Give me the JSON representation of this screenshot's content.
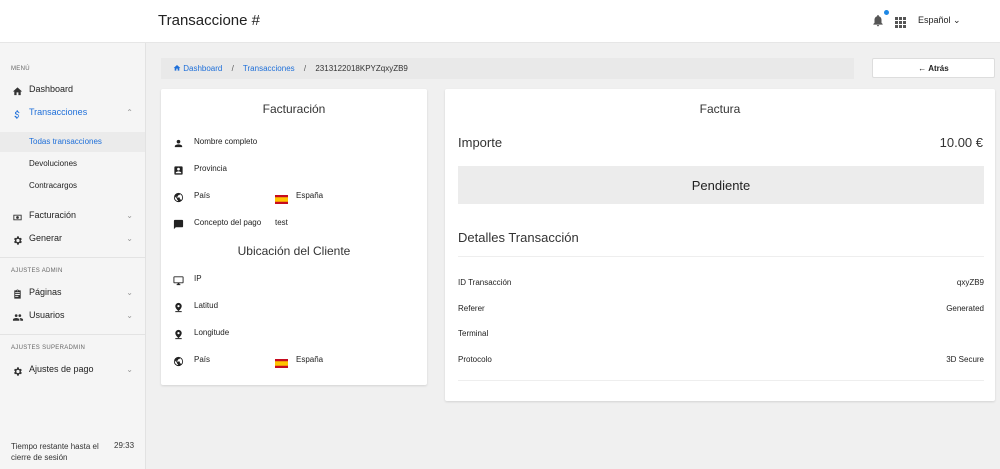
{
  "header": {
    "title": "Transaccione #",
    "language": "Español"
  },
  "sidebar": {
    "menu_label": "MENÚ",
    "items": [
      {
        "label": "Dashboard",
        "icon": "home-icon"
      },
      {
        "label": "Transacciones",
        "icon": "dollar-icon"
      },
      {
        "label": "Facturación",
        "icon": "invoice-icon"
      },
      {
        "label": "Generar",
        "icon": "gear-icon"
      }
    ],
    "sub_items": [
      "Todas transacciones",
      "Devoluciones",
      "Contracargos"
    ],
    "admin_label": "AJUSTES ADMIN",
    "admin_items": [
      {
        "label": "Páginas",
        "icon": "clipboard-icon"
      },
      {
        "label": "Usuarios",
        "icon": "people-icon"
      }
    ],
    "superadmin_label": "AJUSTES SUPERADMIN",
    "superadmin_items": [
      {
        "label": "Ajustes de pago",
        "icon": "gear-icon"
      }
    ],
    "session_text": "Tiempo restante hasta el cierre de sesión",
    "session_time": "29:33"
  },
  "breadcrumb": {
    "home": "Dashboard",
    "section": "Transacciones",
    "current": "2313122018KPYZqxyZB9"
  },
  "back_label": "← Atrás",
  "billing": {
    "title": "Facturación",
    "rows": [
      {
        "label": "Nombre completo",
        "value": ""
      },
      {
        "label": "Provincia",
        "value": ""
      },
      {
        "label": "País",
        "value": "España"
      },
      {
        "label": "Concepto del pago",
        "value": "test"
      }
    ]
  },
  "location": {
    "title": "Ubicación del Cliente",
    "rows": [
      {
        "label": "IP",
        "value": ""
      },
      {
        "label": "Latitud",
        "value": ""
      },
      {
        "label": "Longitude",
        "value": ""
      },
      {
        "label": "País",
        "value": "España"
      }
    ]
  },
  "invoice": {
    "title": "Factura",
    "amount_label": "Importe",
    "amount_value": "10.00 €",
    "status": "Pendiente",
    "details_title": "Detalles Transacción",
    "details": [
      {
        "label": "ID Transacción",
        "value": "qxyZB9"
      },
      {
        "label": "Referer",
        "value": "Generated"
      },
      {
        "label": "Terminal",
        "value": ""
      },
      {
        "label": "Protocolo",
        "value": "3D Secure"
      }
    ]
  },
  "colors": {
    "accent": "#1e6fd9",
    "notification_dot": "#1e88e5"
  }
}
